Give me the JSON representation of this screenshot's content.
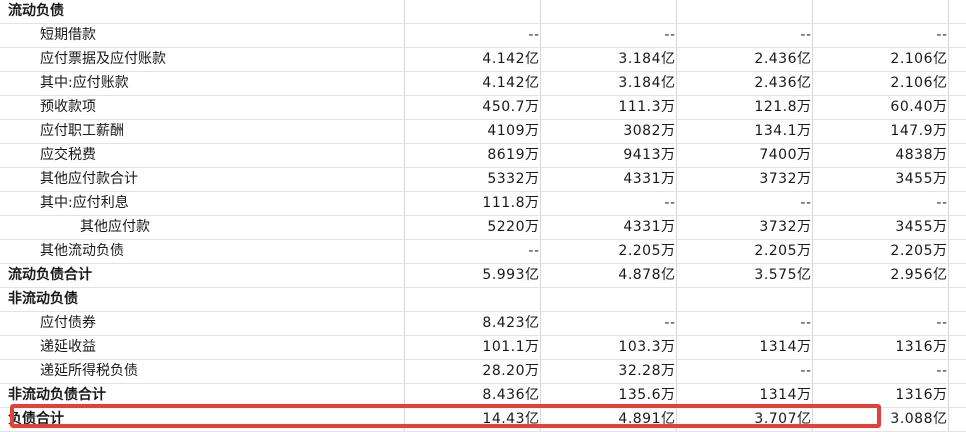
{
  "rows": [
    {
      "label": "流动负债",
      "level": 0,
      "bold": true,
      "values": [
        "",
        "",
        "",
        ""
      ]
    },
    {
      "label": "短期借款",
      "level": 1,
      "bold": false,
      "values": [
        "--",
        "--",
        "--",
        "--"
      ]
    },
    {
      "label": "应付票据及应付账款",
      "level": 1,
      "bold": false,
      "values": [
        "4.142亿",
        "3.184亿",
        "2.436亿",
        "2.106亿"
      ]
    },
    {
      "label": "其中:应付账款",
      "level": 1,
      "bold": false,
      "values": [
        "4.142亿",
        "3.184亿",
        "2.436亿",
        "2.106亿"
      ]
    },
    {
      "label": "预收款项",
      "level": 1,
      "bold": false,
      "values": [
        "450.7万",
        "111.3万",
        "121.8万",
        "60.40万"
      ]
    },
    {
      "label": "应付职工薪酬",
      "level": 1,
      "bold": false,
      "values": [
        "4109万",
        "3082万",
        "134.1万",
        "147.9万"
      ]
    },
    {
      "label": "应交税费",
      "level": 1,
      "bold": false,
      "values": [
        "8619万",
        "9413万",
        "7400万",
        "4838万"
      ]
    },
    {
      "label": "其他应付款合计",
      "level": 1,
      "bold": false,
      "values": [
        "5332万",
        "4331万",
        "3732万",
        "3455万"
      ]
    },
    {
      "label": "其中:应付利息",
      "level": 1,
      "bold": false,
      "values": [
        "111.8万",
        "--",
        "--",
        "--"
      ]
    },
    {
      "label": "其他应付款",
      "level": 2,
      "bold": false,
      "values": [
        "5220万",
        "4331万",
        "3732万",
        "3455万"
      ]
    },
    {
      "label": "其他流动负债",
      "level": 1,
      "bold": false,
      "values": [
        "--",
        "2.205万",
        "2.205万",
        "2.205万"
      ]
    },
    {
      "label": "流动负债合计",
      "level": 0,
      "bold": true,
      "values": [
        "5.993亿",
        "4.878亿",
        "3.575亿",
        "2.956亿"
      ]
    },
    {
      "label": "非流动负债",
      "level": 0,
      "bold": true,
      "values": [
        "",
        "",
        "",
        ""
      ]
    },
    {
      "label": "应付债券",
      "level": 1,
      "bold": false,
      "values": [
        "8.423亿",
        "--",
        "--",
        "--"
      ]
    },
    {
      "label": "递延收益",
      "level": 1,
      "bold": false,
      "values": [
        "101.1万",
        "103.3万",
        "1314万",
        "1316万"
      ]
    },
    {
      "label": "递延所得税负债",
      "level": 1,
      "bold": false,
      "values": [
        "28.20万",
        "32.28万",
        "--",
        "--"
      ]
    },
    {
      "label": "非流动负债合计",
      "level": 0,
      "bold": true,
      "values": [
        "8.436亿",
        "135.6万",
        "1314万",
        "1316万"
      ]
    },
    {
      "label": "负债合计",
      "level": 0,
      "bold": true,
      "values": [
        "14.43亿",
        "4.891亿",
        "3.707亿",
        "3.088亿"
      ]
    }
  ],
  "highlight_color": "#e3403a"
}
